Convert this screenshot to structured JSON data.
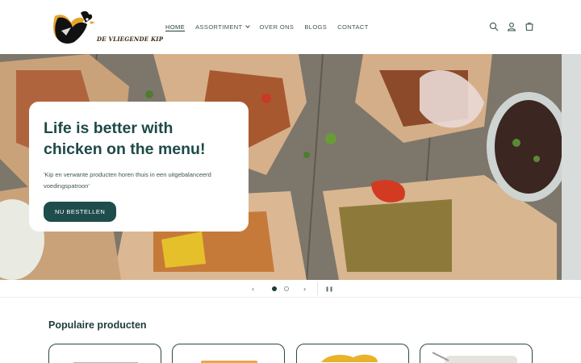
{
  "brand": {
    "name": "DE VLIEGENDE KIP"
  },
  "nav": [
    {
      "label": "HOME",
      "active": true
    },
    {
      "label": "ASSORTIMENT",
      "active": false,
      "dropdown": true
    },
    {
      "label": "OVER ONS",
      "active": false
    },
    {
      "label": "BLOGS",
      "active": false
    },
    {
      "label": "CONTACT",
      "active": false
    }
  ],
  "header_icons": [
    "search-icon",
    "account-icon",
    "cart-icon"
  ],
  "hero": {
    "title": "Life is better with chicken on the menu!",
    "subtitle": "'Kip en verwante producten horen thuis in een uitgebalanceerd voedingspatroon'",
    "cta": "NU BESTELLEN"
  },
  "slider": {
    "prev": "‹",
    "next": "›",
    "pause": "❚❚",
    "slides": 2,
    "current": 1
  },
  "products": {
    "title": "Populaire producten",
    "count_visible": 4
  },
  "colors": {
    "primary": "#1f4d4b",
    "text": "#1f3b3a",
    "accent_yellow": "#e8a92a"
  }
}
